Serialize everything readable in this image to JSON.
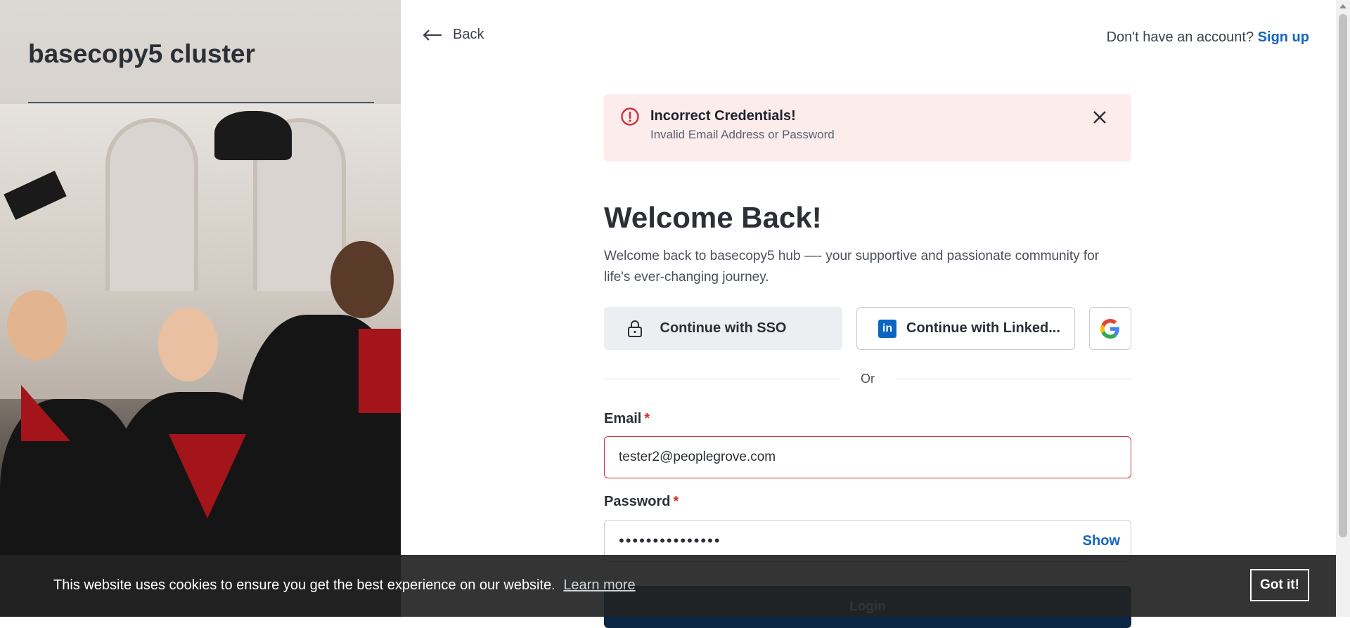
{
  "sidebar": {
    "org_name": "basecopy5 cluster"
  },
  "header": {
    "back_label": "Back",
    "signup_prompt": "Don't have an account?",
    "signup_link": "Sign up"
  },
  "alert": {
    "title": "Incorrect Credentials!",
    "message": "Invalid Email Address or Password"
  },
  "main": {
    "title": "Welcome Back!",
    "subtitle": "Welcome back to basecopy5 hub —- your supportive and passionate community for life's ever-changing journey.",
    "sso_label": "Continue with SSO",
    "linkedin_label": "Continue with Linked...",
    "linkedin_icon_text": "in",
    "or_label": "Or",
    "email_label": "Email",
    "email_value": "tester2@peoplegrove.com",
    "required_mark": "*",
    "password_label": "Password",
    "password_mask": "•••••••••••••••",
    "show_label": "Show",
    "login_label": "Login"
  },
  "cookie": {
    "message": "This website uses cookies to ensure you get the best experience on our website.",
    "learn_more": "Learn more",
    "accept_label": "Got it!"
  },
  "colors": {
    "accent": "#1665c0",
    "error": "#d0313a",
    "login_button": "#0b2545",
    "alert_bg": "#fdecec"
  }
}
